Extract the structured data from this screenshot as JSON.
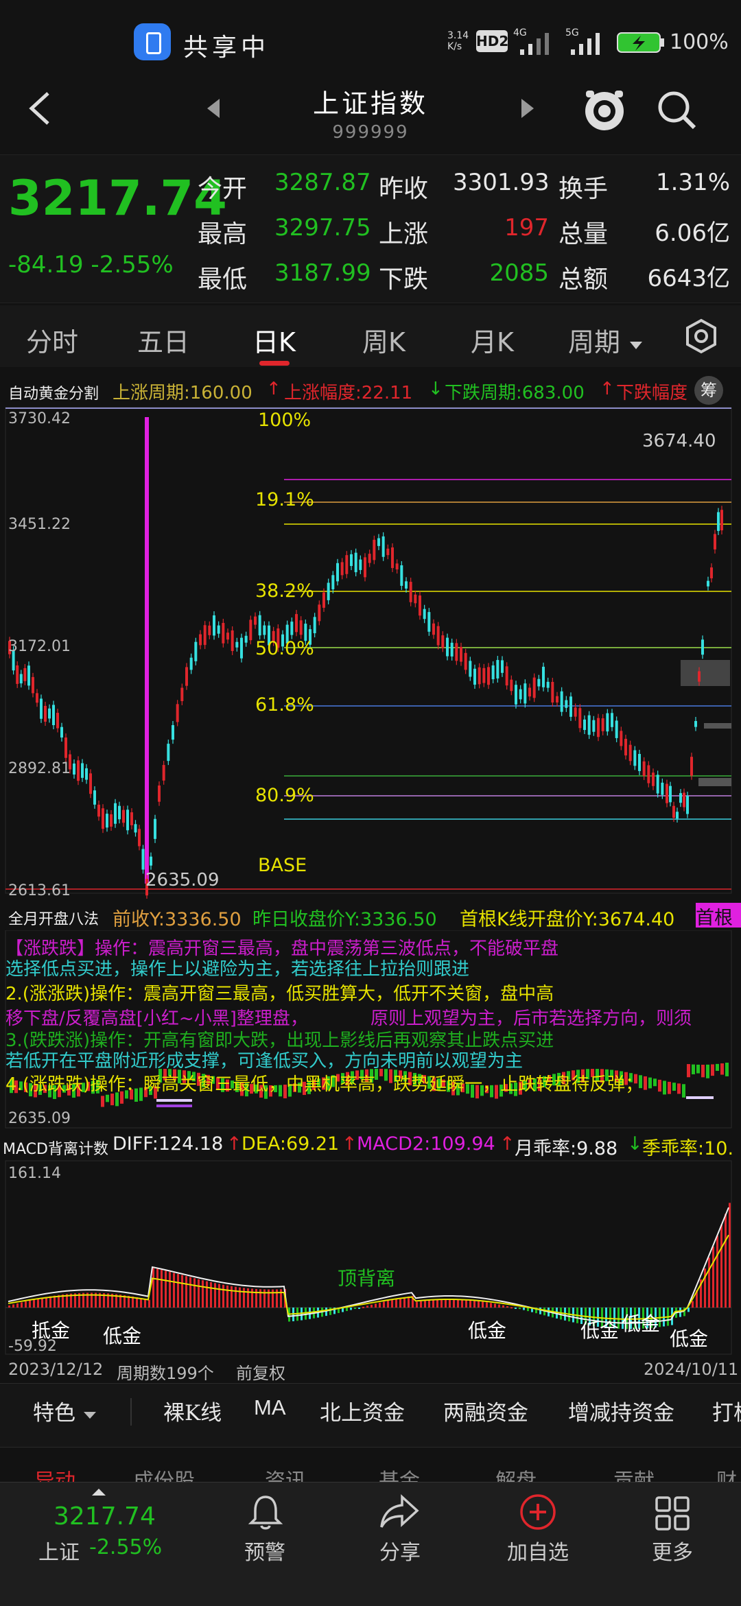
{
  "status_bar": {
    "sharing_label": "共享中",
    "net_speed": "3.14 K/s",
    "hd": "HD2",
    "net1": "4G",
    "net2": "5G",
    "battery": "100%"
  },
  "header": {
    "title": "上证指数",
    "code": "999999"
  },
  "quote": {
    "price": "3217.74",
    "change": "-84.19",
    "change_pct": "-2.55%",
    "rows": [
      {
        "l1": "今开",
        "v1": "3287.87",
        "l2": "昨收",
        "v2": "3301.93",
        "l3": "换手",
        "v3": "1.31%"
      },
      {
        "l1": "最高",
        "v1": "3297.75",
        "l2": "上涨",
        "v2": "197",
        "l3": "总量",
        "v3": "6.06亿"
      },
      {
        "l1": "最低",
        "v1": "3187.99",
        "l2": "下跌",
        "v2": "2085",
        "l3": "总额",
        "v3": "6643亿"
      }
    ]
  },
  "tabs": [
    "分时",
    "五日",
    "日K",
    "周K",
    "月K",
    "周期"
  ],
  "active_tab": "日K",
  "golden": {
    "name": "自动黄金分割",
    "up_period": "上涨周期:160.00",
    "up_amp": "上涨幅度:22.11",
    "down_period": "下跌周期:683.00",
    "down_amp": "下跌幅度",
    "chip_btn": "筹"
  },
  "main_chart": {
    "y_labels": [
      "3730.42",
      "3451.22",
      "3172.01",
      "2892.81",
      "2613.61"
    ],
    "fib_labels": [
      "100%",
      "19.1%",
      "38.2%",
      "50.0%",
      "61.8%",
      "80.9%",
      "BASE"
    ],
    "high_label": "3674.40",
    "low_label": "2635.09"
  },
  "eight_methods": {
    "name": "全月开盘八法",
    "prev_close": "前收Y:3336.50",
    "yest_close": "昨日收盘价Y:3336.50",
    "first_open": "首根K线开盘价Y:3674.40",
    "first_open_cut": "首根",
    "bottom_label": "2635.09",
    "lines": [
      "2.(涨涨跌)操作：震高开窗三最高，低买胜算大，低开不关窗，盘中高",
      "4.(涨跌跌)操作：瞬高关窗三最低，中黑机率高，跌势延瞬一，止跌转盘待反弹；",
      "原则上观望为主，后市若选择方向，则须",
      "移下盘/反覆高盘[小红~小黑]整理盘，"
    ]
  },
  "macd": {
    "name": "MACD背离计数",
    "diff": "DIFF:124.18",
    "dea": "DEA:69.21",
    "macd2": "MACD2:109.94",
    "month_rate": "月乖率:9.88",
    "season_rate": "季乖率:10.",
    "top_label": "161.14",
    "bottom_label": "-59.92",
    "marks": [
      "顶背离",
      "抵金",
      "低金",
      "低金",
      "低金",
      "低金",
      "低金"
    ]
  },
  "dates": {
    "start": "2023/12/12",
    "period_count": "周期数199个",
    "adjust": "前复权",
    "end": "2024/10/11"
  },
  "toolbar": {
    "items": [
      "特色",
      "裸K线",
      "MA",
      "北上资金",
      "两融资金",
      "增减持资金",
      "打板"
    ]
  },
  "subnav": {
    "items": [
      "异动",
      "成份股",
      "资讯",
      "基金",
      "解盘",
      "贡献",
      "财"
    ]
  },
  "bottom_nav": {
    "price": "3217.74",
    "index_label": "上证",
    "pct": "-2.55%",
    "items": [
      "预警",
      "分享",
      "加自选",
      "更多"
    ]
  },
  "colors": {
    "up": "#e0262c",
    "down": "#21c021",
    "yellow": "#e7e300",
    "cyan": "#36e0e0",
    "magenta": "#e020e0"
  }
}
